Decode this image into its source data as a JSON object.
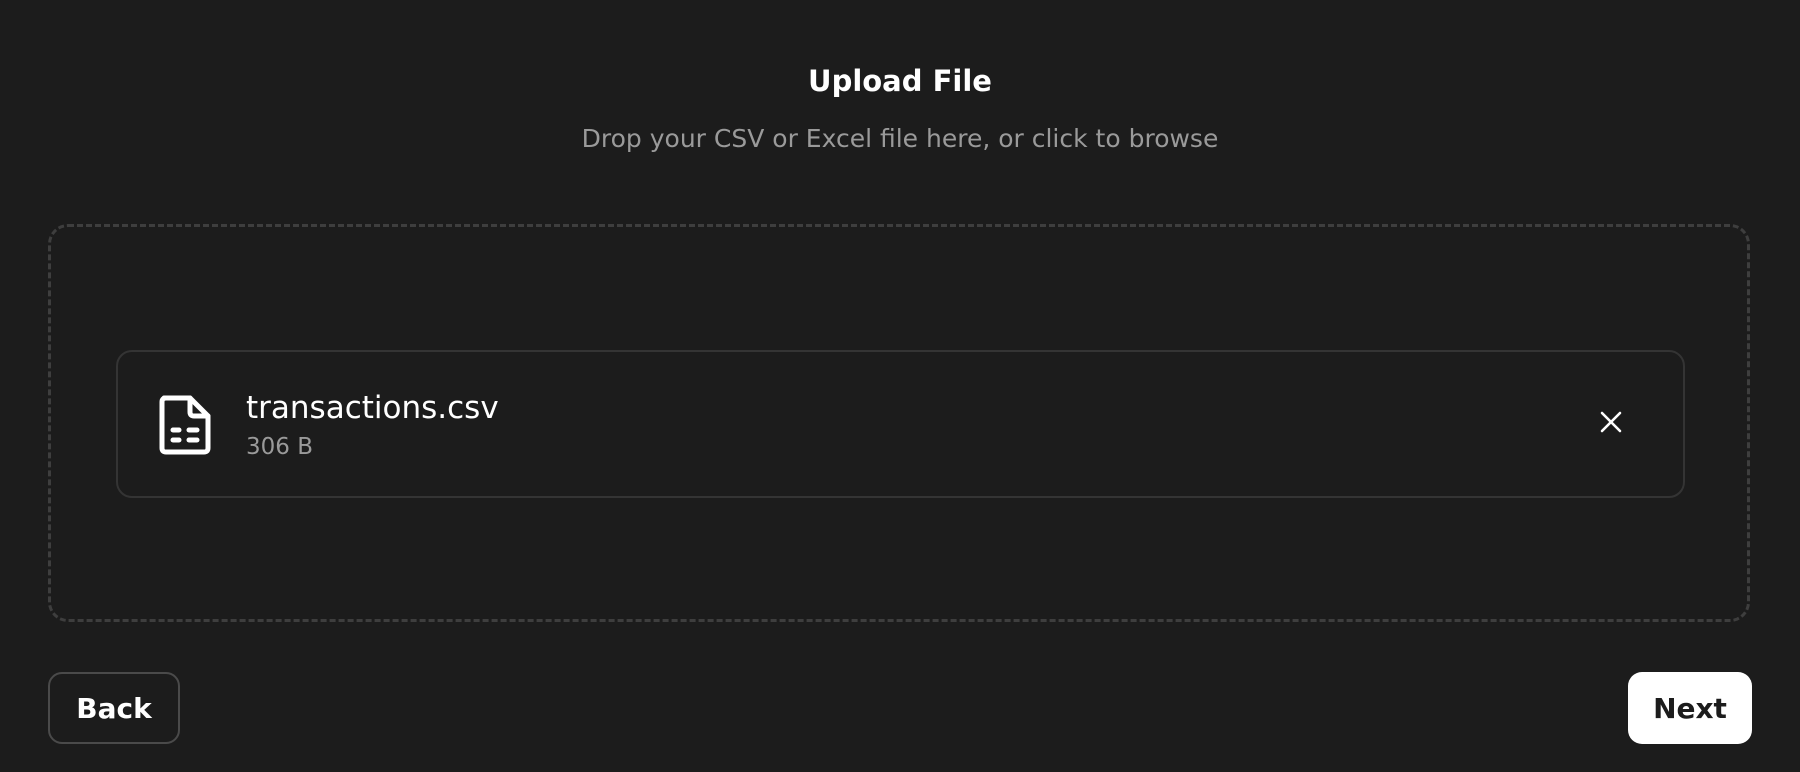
{
  "header": {
    "title": "Upload File",
    "subtitle": "Drop your CSV or Excel file here, or click to browse"
  },
  "file": {
    "name": "transactions.csv",
    "size": "306 B",
    "icon": "file-spreadsheet-icon",
    "remove_icon": "close-icon"
  },
  "footer": {
    "back_label": "Back",
    "next_label": "Next"
  },
  "colors": {
    "background": "#1c1c1c",
    "primary_text": "#ffffff",
    "muted_text": "#9a9a9a",
    "border": "#343434",
    "primary_button_bg": "#ffffff"
  }
}
